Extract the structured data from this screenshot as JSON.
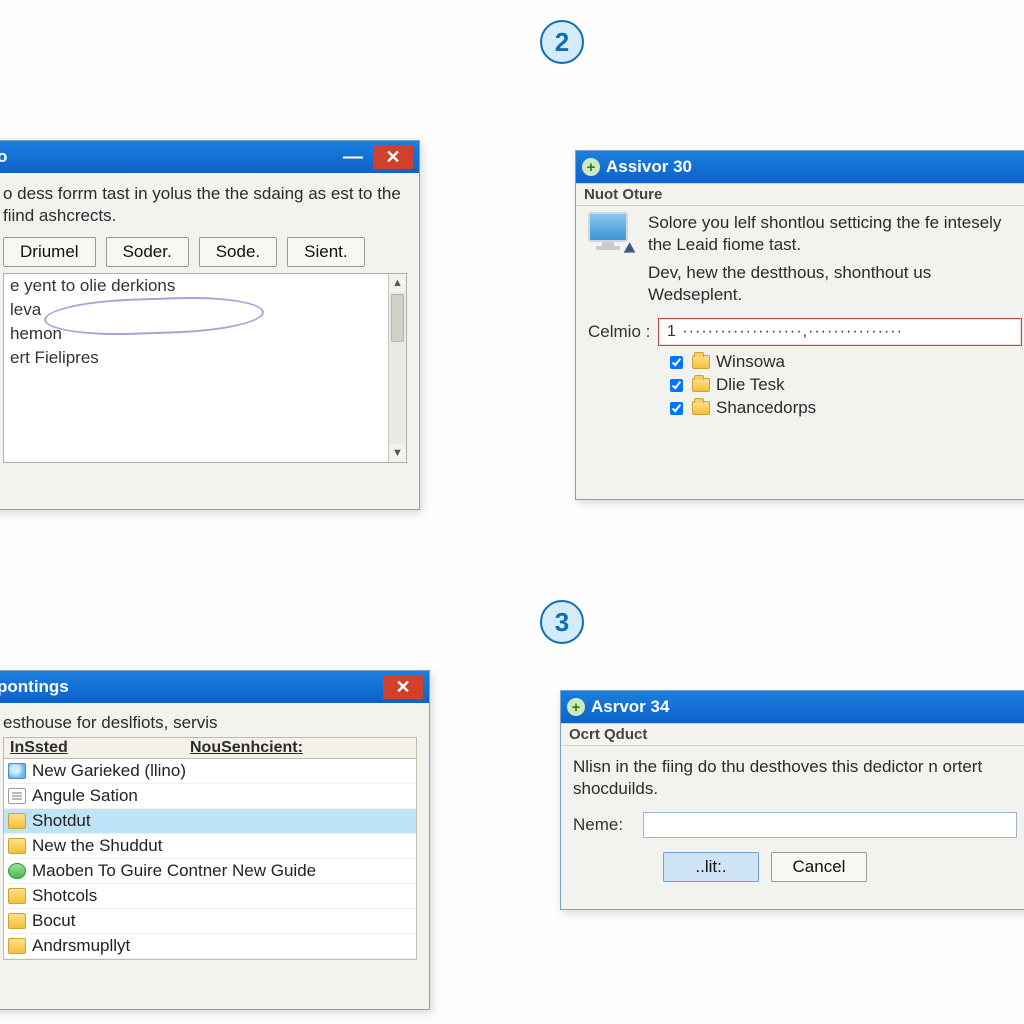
{
  "step_badges": {
    "two": "2",
    "three": "3"
  },
  "window1": {
    "title": "o",
    "desc": "o dess forrm tast in yolus the the sdaing as est to the fiind ashcrects.",
    "buttons": {
      "b1": "Driumel",
      "b2": "Soder.",
      "b3": "Sode.",
      "b4": "Sient."
    },
    "list": {
      "l1": "e yent to olie derkions",
      "l2": "leva",
      "l3": "hemon",
      "l4": "ert Fielipres"
    }
  },
  "window2": {
    "title": "Assivor 30",
    "subheader": "Nuot Oture",
    "p1": "Solore you lelf shontlou setticing the fe intesely the Leaid fiome tast.",
    "p2": "Dev, hew the destthous, shonthout us Wedseplent.",
    "celmio_label": "Celmio :",
    "celmio_value": "1 ···················,···············",
    "items": {
      "i1": "Winsowa",
      "i2": "Dlie Tesk",
      "i3": "Shancedorps"
    }
  },
  "window3": {
    "title": "pontings",
    "desc": "esthouse for deslfiots, servis",
    "col1": "InSsted",
    "col2": "NouSenhcient:",
    "rows": {
      "r1": "New Garieked (llino)",
      "r2": "Angule Sation",
      "r3": "Shotdut",
      "r4": "New the Shuddut",
      "r5": "Maoben To Guire Contner New Guide",
      "r6": "Shotcols",
      "r7": "Bocut",
      "r8": "Andrsmupllyt"
    }
  },
  "window4": {
    "title": "Asrvor 34",
    "subheader": "Ocrt Qduct",
    "desc": "Nlisn in the fiing do thu desthoves this dedictor n ortert shocduilds.",
    "name_label": "Neme:",
    "name_value": "",
    "buttons": {
      "ok": "..lit:.",
      "cancel": "Cancel"
    }
  }
}
